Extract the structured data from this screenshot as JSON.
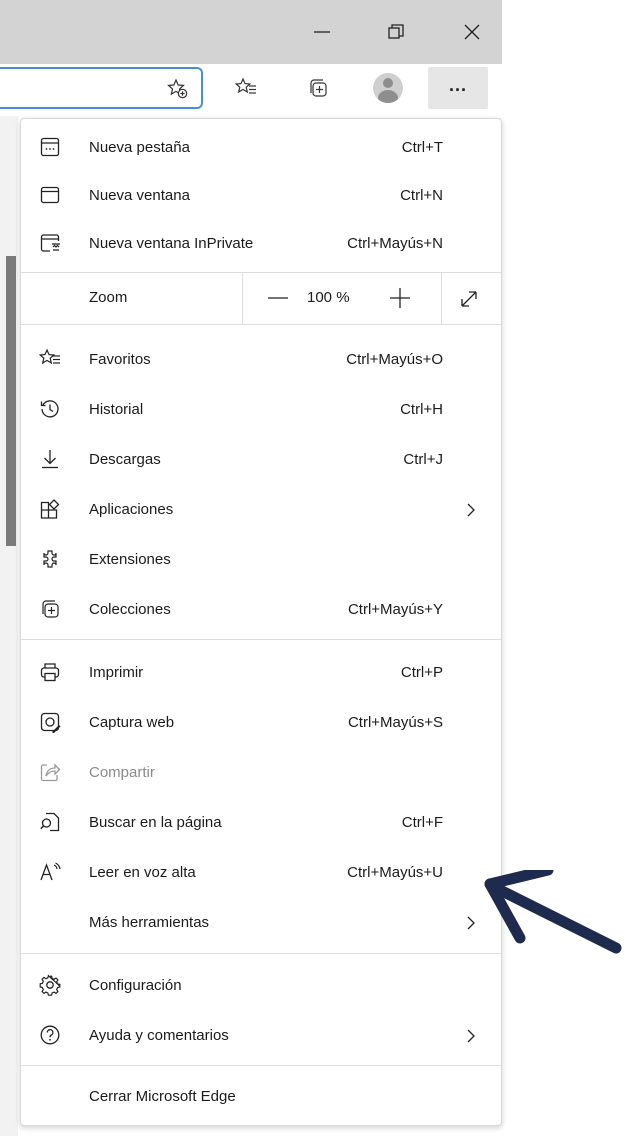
{
  "menu": {
    "items_top": [
      {
        "label": "Nueva pestaña",
        "shortcut": "Ctrl+T"
      },
      {
        "label": "Nueva ventana",
        "shortcut": "Ctrl+N"
      },
      {
        "label": "Nueva ventana InPrivate",
        "shortcut": "Ctrl+Mayús+N"
      }
    ],
    "zoom": {
      "label": "Zoom",
      "value": "100 %"
    },
    "items_mid": [
      {
        "label": "Favoritos",
        "shortcut": "Ctrl+Mayús+O"
      },
      {
        "label": "Historial",
        "shortcut": "Ctrl+H"
      },
      {
        "label": "Descargas",
        "shortcut": "Ctrl+J"
      },
      {
        "label": "Aplicaciones",
        "shortcut": ""
      },
      {
        "label": "Extensiones",
        "shortcut": ""
      },
      {
        "label": "Colecciones",
        "shortcut": "Ctrl+Mayús+Y"
      }
    ],
    "items_tools": [
      {
        "label": "Imprimir",
        "shortcut": "Ctrl+P"
      },
      {
        "label": "Captura web",
        "shortcut": "Ctrl+Mayús+S"
      },
      {
        "label": "Compartir",
        "shortcut": ""
      },
      {
        "label": "Buscar en la página",
        "shortcut": "Ctrl+F"
      },
      {
        "label": "Leer en voz alta",
        "shortcut": "Ctrl+Mayús+U"
      },
      {
        "label": "Más herramientas",
        "shortcut": ""
      }
    ],
    "items_bottom": [
      {
        "label": "Configuración",
        "shortcut": ""
      },
      {
        "label": "Ayuda y comentarios",
        "shortcut": ""
      }
    ],
    "close_label": "Cerrar Microsoft Edge"
  },
  "toolbar": {
    "more_label": "..."
  },
  "colors": {
    "titlebar": "#d3d3d3",
    "address_focus": "#4a8fd6",
    "annotation_arrow": "#1f2a4f"
  }
}
